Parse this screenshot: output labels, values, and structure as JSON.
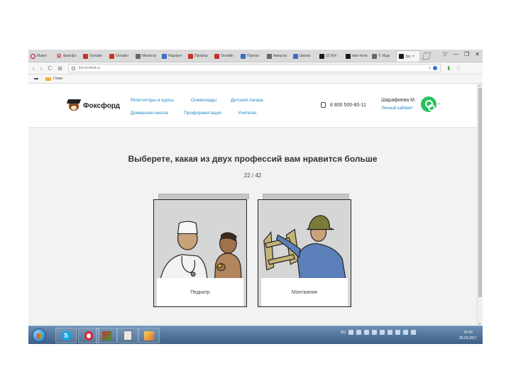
{
  "browser": {
    "tabs": [
      {
        "label": "Макет",
        "fav": "o"
      },
      {
        "label": "фоксфо",
        "fav": "ya"
      },
      {
        "label": "Онлайн",
        "fav": "red"
      },
      {
        "label": "Онлайн",
        "fav": "red"
      },
      {
        "label": "Министр",
        "fav": "gray"
      },
      {
        "label": "Нацпрог",
        "fav": "sq"
      },
      {
        "label": "Профор",
        "fav": "red"
      },
      {
        "label": "Онлайн",
        "fav": "red"
      },
      {
        "label": "Портал",
        "fav": "sq"
      },
      {
        "label": "Авиастр",
        "fav": "gray"
      },
      {
        "label": "Школа",
        "fav": "sq"
      },
      {
        "label": "(2) Юл",
        "fav": "x"
      },
      {
        "label": "имя поли",
        "fav": "x"
      },
      {
        "label": "V. Ищи",
        "fav": "vk"
      },
      {
        "label": "Заг",
        "fav": "x",
        "active": true
      }
    ],
    "window_controls": [
      "▽",
      "—",
      "❐",
      "✕"
    ],
    "nav": {
      "back": "‹",
      "forward": "›",
      "reload": "C",
      "grid": "⊞"
    },
    "url": "lms.foxford.ru",
    "url_badge": "1",
    "bookmarks": [
      {
        "label": "Главн"
      }
    ]
  },
  "site": {
    "logo_text": "Фоксфорд",
    "menu_top": [
      "Репетиторы и курсы",
      "Олимпиады",
      "Детский лагерь"
    ],
    "menu_bottom": [
      "Домашняя школа",
      "Профориентация",
      "Учителю"
    ],
    "phone": "8 800 500-80-11",
    "user_name": "Шарафиева М.",
    "user_link": "Личный кабинет",
    "colors": {
      "link": "#1e88c8",
      "avatar": "#25c35a"
    }
  },
  "quiz": {
    "question": "Выберете, какая из двух профессий вам нравится больше",
    "counter": "22 / 42",
    "options": [
      {
        "label": "Педиатр",
        "icon": "doctor-with-child-illustration"
      },
      {
        "label": "Монтажник",
        "icon": "worker-carrying-ladder-illustration"
      }
    ]
  },
  "taskbar": {
    "apps": [
      "skype-icon",
      "opera-icon",
      "mixed-app-icon",
      "calculator-icon",
      "paint-icon"
    ],
    "tray_lang": "RU",
    "clock_time": "16:40",
    "clock_date": "28.09.2017"
  }
}
